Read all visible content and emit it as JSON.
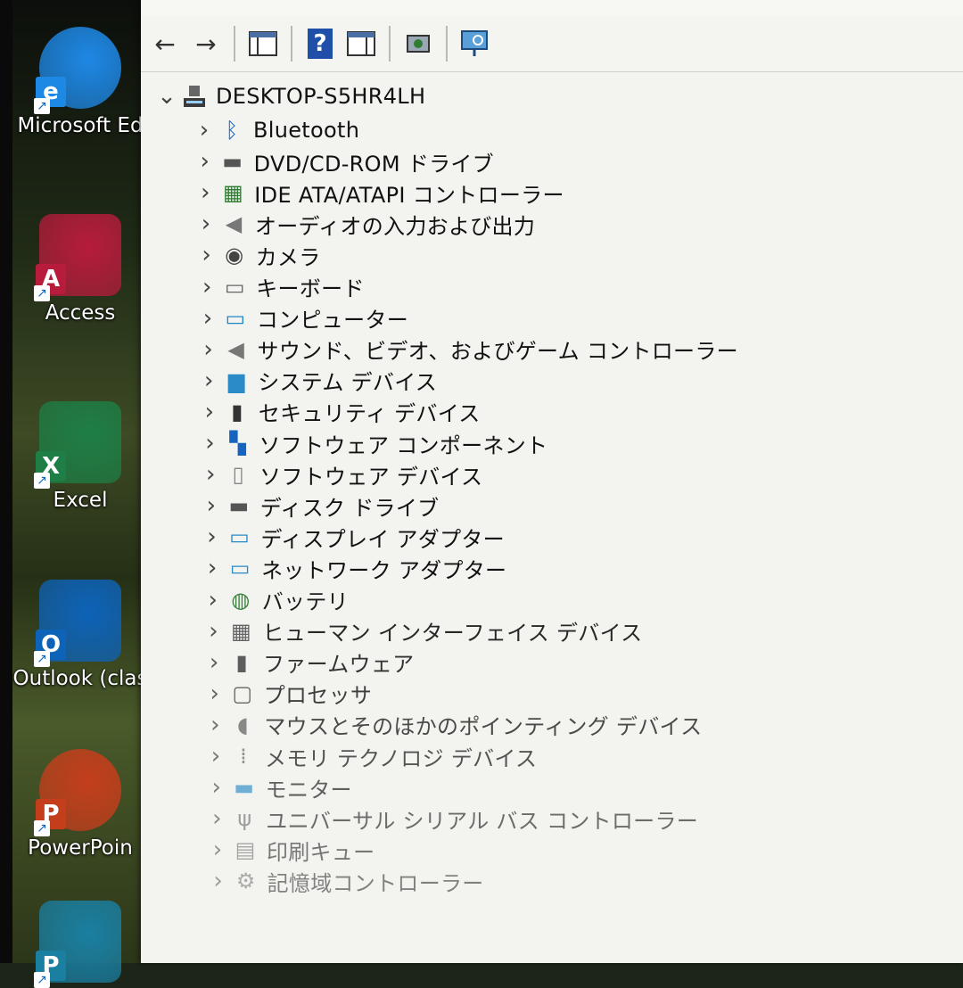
{
  "desktop": {
    "icons": [
      {
        "label": "Microsoft Ed",
        "color": "#1e88e5",
        "mark": "e"
      },
      {
        "label": "Access",
        "color": "#b71c3c",
        "mark": "A"
      },
      {
        "label": "Excel",
        "color": "#1e7e45",
        "mark": "X"
      },
      {
        "label": "Outlook (clas",
        "color": "#0d63b8",
        "mark": "O"
      },
      {
        "label": "PowerPoin",
        "color": "#c43e1c",
        "mark": "P"
      },
      {
        "label": "",
        "color": "#1a7fa1",
        "mark": "P"
      }
    ]
  },
  "window": {
    "toolbar": {
      "back_icon": "←",
      "forward_icon": "→",
      "help_icon": "?"
    },
    "tree": {
      "root": "DESKTOP-S5HR4LH",
      "root_icon": "computer-icon",
      "categories": [
        {
          "label": "Bluetooth",
          "icon": "bluetooth-icon",
          "glyph": "ᛒ",
          "color": "#1565c0"
        },
        {
          "label": "DVD/CD-ROM ドライブ",
          "icon": "dvd-drive-icon",
          "glyph": "▬",
          "color": "#555"
        },
        {
          "label": "IDE ATA/ATAPI コントローラー",
          "icon": "ide-controller-icon",
          "glyph": "▦",
          "color": "#2e7d32"
        },
        {
          "label": "オーディオの入力および出力",
          "icon": "speaker-icon",
          "glyph": "◀",
          "color": "#777"
        },
        {
          "label": "カメラ",
          "icon": "camera-icon",
          "glyph": "◉",
          "color": "#444"
        },
        {
          "label": "キーボード",
          "icon": "keyboard-icon",
          "glyph": "▭",
          "color": "#666"
        },
        {
          "label": "コンピューター",
          "icon": "monitor-icon",
          "glyph": "▭",
          "color": "#1e88c7"
        },
        {
          "label": "サウンド、ビデオ、およびゲーム コントローラー",
          "icon": "sound-icon",
          "glyph": "◀",
          "color": "#777"
        },
        {
          "label": "システム デバイス",
          "icon": "system-folder-icon",
          "glyph": "▆",
          "color": "#2a8bc8"
        },
        {
          "label": "セキュリティ デバイス",
          "icon": "security-key-icon",
          "glyph": "▮",
          "color": "#333"
        },
        {
          "label": "ソフトウェア コンポーネント",
          "icon": "component-icon",
          "glyph": "▚",
          "color": "#1565c0"
        },
        {
          "label": "ソフトウェア デバイス",
          "icon": "software-device-icon",
          "glyph": "▯",
          "color": "#888"
        },
        {
          "label": "ディスク ドライブ",
          "icon": "disk-drive-icon",
          "glyph": "▬",
          "color": "#555"
        },
        {
          "label": "ディスプレイ アダプター",
          "icon": "display-adapter-icon",
          "glyph": "▭",
          "color": "#2a8bc8"
        },
        {
          "label": "ネットワーク アダプター",
          "icon": "network-adapter-icon",
          "glyph": "▭",
          "color": "#2a8bc8"
        },
        {
          "label": "バッテリ",
          "icon": "battery-icon",
          "glyph": "◍",
          "color": "#2e7d32"
        },
        {
          "label": "ヒューマン インターフェイス デバイス",
          "icon": "hid-icon",
          "glyph": "▦",
          "color": "#555"
        },
        {
          "label": "ファームウェア",
          "icon": "firmware-icon",
          "glyph": "▮",
          "color": "#444"
        },
        {
          "label": "プロセッサ",
          "icon": "processor-icon",
          "glyph": "▢",
          "color": "#444"
        },
        {
          "label": "マウスとそのほかのポインティング デバイス",
          "icon": "mouse-icon",
          "glyph": "◖",
          "color": "#666"
        },
        {
          "label": "メモリ テクノロジ デバイス",
          "icon": "memory-icon",
          "glyph": "⁞",
          "color": "#666"
        },
        {
          "label": "モニター",
          "icon": "monitor-icon",
          "glyph": "▬",
          "color": "#2a8bc8"
        },
        {
          "label": "ユニバーサル シリアル バス コントローラー",
          "icon": "usb-icon",
          "glyph": "ψ",
          "color": "#666"
        },
        {
          "label": "印刷キュー",
          "icon": "printer-icon",
          "glyph": "▤",
          "color": "#666"
        },
        {
          "label": "記憶域コントローラー",
          "icon": "storage-controller-icon",
          "glyph": "⚙",
          "color": "#666"
        }
      ]
    }
  }
}
